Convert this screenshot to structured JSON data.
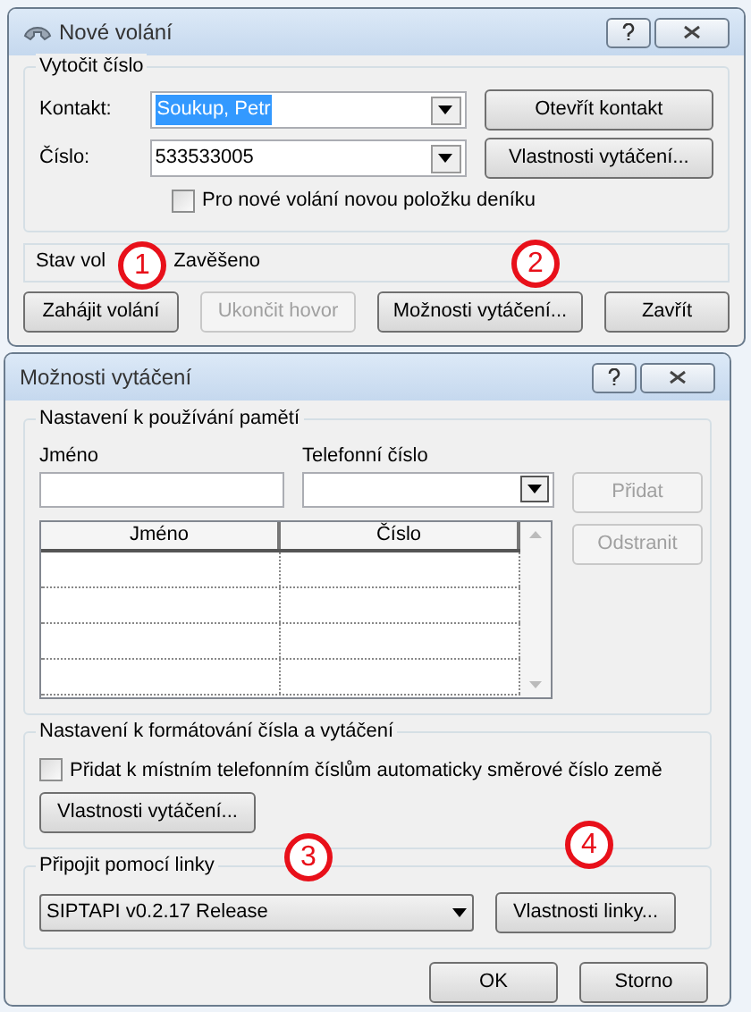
{
  "call_window": {
    "title": "Nové volání",
    "dial_group": {
      "title": "Vytočit číslo",
      "contact_label": "Kontakt:",
      "contact_value": "Soukup, Petr",
      "number_label": "Číslo:",
      "number_value": "533533005",
      "open_contact": "Otevřít kontakt",
      "dial_properties": "Vlastnosti vytáčení...",
      "journal_checkbox": {
        "label": "Pro nové volání novou položku deníku",
        "checked": false
      }
    },
    "status": {
      "label": "Stav vol",
      "value": "Zavěšeno"
    },
    "buttons": [
      {
        "label": "Zahájit volání",
        "disabled": false
      },
      {
        "label": "Ukončit hovor",
        "disabled": true
      },
      {
        "label": "Možnosti vytáčení...",
        "disabled": false
      },
      {
        "label": "Zavřít",
        "disabled": false
      }
    ]
  },
  "options_window": {
    "title": "Možnosti vytáčení",
    "memory_group": {
      "title": "Nastavení k používání pamětí",
      "name_label": "Jméno",
      "phone_label": "Telefonní číslo",
      "add_button": {
        "label": "Přidat",
        "disabled": true
      },
      "remove_button": {
        "label": "Odstranit",
        "disabled": true
      },
      "table": {
        "columns": [
          "Jméno",
          "Číslo"
        ]
      }
    },
    "format_group": {
      "title": "Nastavení k formátování čísla a vytáčení",
      "checkbox": {
        "label": "Přidat k místním telefonním číslům automaticky směrové číslo země",
        "checked": false
      },
      "button": "Vlastnosti vytáčení..."
    },
    "line_group": {
      "title": "Připojit pomocí linky",
      "line_value": "SIPTAPI v0.2.17 Release",
      "button": "Vlastnosti linky..."
    },
    "buttons": [
      "OK",
      "Storno"
    ]
  },
  "annotations": [
    "1",
    "2",
    "3",
    "4"
  ]
}
